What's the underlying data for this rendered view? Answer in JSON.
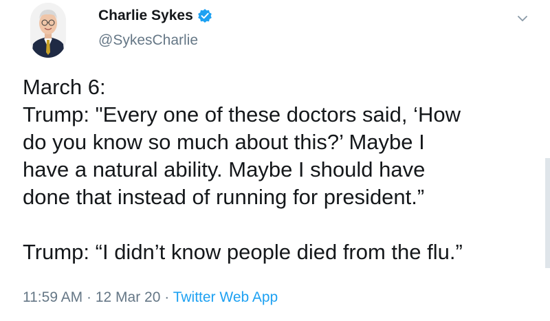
{
  "author": {
    "display_name": "Charlie Sykes",
    "handle": "@SykesCharlie",
    "verified": true,
    "avatar_icon": "avatar-photo"
  },
  "tweet": {
    "lines": [
      "March 6:",
      "Trump: \"Every one of these doctors said, ‘How",
      "do you know so much about this?’ Maybe I",
      "have a natural ability. Maybe I should have",
      "done that instead of running for president.”"
    ],
    "final_line": "Trump: “I didn’t know people died from the flu.”"
  },
  "meta": {
    "time": "11:59 AM",
    "separator": " · ",
    "date": "12 Mar 20",
    "source": "Twitter Web App"
  },
  "colors": {
    "text": "#14171a",
    "muted": "#657786",
    "accent": "#1da1f2"
  },
  "icons": {
    "verified": "verified-badge-icon",
    "menu": "chevron-down-icon"
  }
}
